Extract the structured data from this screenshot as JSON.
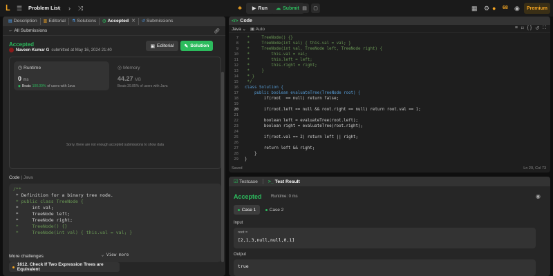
{
  "topbar": {
    "title": "Problem List",
    "run_label": "Run",
    "submit_label": "Submit",
    "streak": "68",
    "premium_label": "Premium",
    "accent": "#f5a623"
  },
  "left_tabs": [
    {
      "label": "Description",
      "icon": "description-icon"
    },
    {
      "label": "Editorial",
      "icon": "editorial-icon"
    },
    {
      "label": "Solutions",
      "icon": "flask-icon"
    },
    {
      "label": "Accepted",
      "icon": "clock-icon"
    },
    {
      "label": "Submissions",
      "icon": "history-icon"
    }
  ],
  "submission": {
    "back_label": "All Submissions",
    "status": "Accepted",
    "author": "Naveen Kumar G",
    "submitted_at": "submitted at May 16, 2024 21:40",
    "editorial_label": "Editorial",
    "solution_label": "Solution",
    "runtime": {
      "label": "Runtime",
      "value": "0",
      "unit": "ms",
      "beats_pct": "100.00%",
      "beats_text": "of users with Java"
    },
    "memory": {
      "label": "Memory",
      "value": "44.27",
      "unit": "MB",
      "beats_text": "Beats 39.85% of users with Java"
    },
    "empty_message": "Sorry, there are not enough accepted submissions to show data",
    "code_label": "Code",
    "code_lang": "Java",
    "view_more": "View more",
    "code_preview": [
      "/**",
      " * Definition for a binary tree node.",
      " * public class TreeNode {",
      " *     int val;",
      " *     TreeNode left;",
      " *     TreeNode right;",
      " *     TreeNode() {}",
      " *     TreeNode(int val) { this.val = val; }"
    ]
  },
  "more_challenges": {
    "title": "More challenges",
    "items": [
      "1612. Check If Two Expression Trees are Equivalent"
    ]
  },
  "editor": {
    "title": "Code",
    "language": "Java",
    "mode": "Auto",
    "status_saved": "Saved",
    "cursor": "Ln 20, Col 73",
    "current_line": "20",
    "line_numbers": [
      "7",
      "8",
      "9",
      "10",
      "11",
      "12",
      "13",
      "14",
      "15",
      "16",
      "17",
      "18",
      "19",
      "20",
      "21",
      "22",
      "23",
      "24",
      "25",
      "26",
      "27",
      "28",
      "29"
    ],
    "lines": [
      " *     TreeNode() {}",
      " *     TreeNode(int val) { this.val = val; }",
      " *     TreeNode(int val, TreeNode left, TreeNode right) {",
      " *         this.val = val;",
      " *         this.left = left;",
      " *         this.right = right;",
      " *     }",
      " * }",
      " */",
      "class Solution {",
      "    public boolean evaluateTree(TreeNode root) {",
      "        if(root  == null) return false;",
      "",
      "        if(root.left == null && root.right == null) return root.val == 1;",
      "",
      "        boolean left = evaluateTree(root.left);",
      "        boolean right = evaluateTree(root.right);",
      "",
      "        if(root.val == 2) return left || right;",
      "",
      "        return left && right;",
      "    }",
      "}"
    ]
  },
  "result": {
    "tab_testcase": "Testcase",
    "tab_result": "Test Result",
    "status": "Accepted",
    "runtime": "Runtime: 0 ms",
    "cases": [
      "Case 1",
      "Case 2"
    ],
    "input_label": "Input",
    "param_name": "root =",
    "param_value": "[2,1,3,null,null,0,1]",
    "output_label": "Output",
    "output_value": "true"
  }
}
